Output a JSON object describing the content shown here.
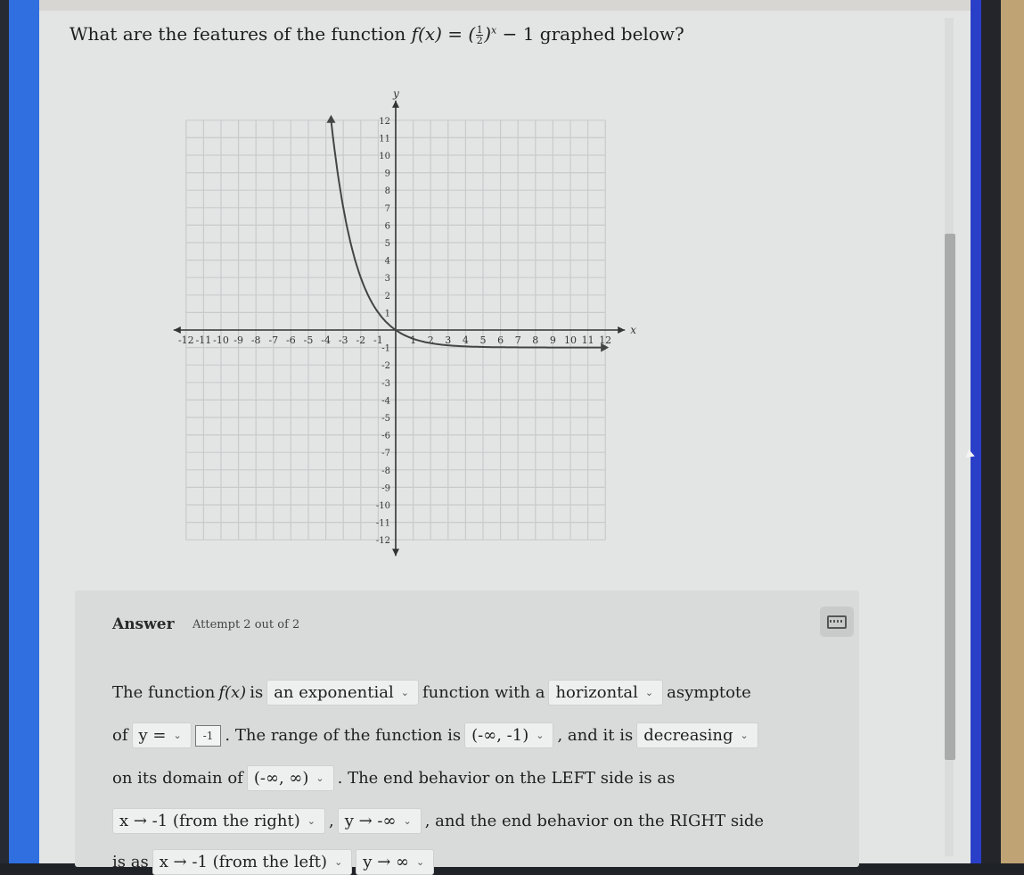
{
  "question": {
    "prefix": "What are the features of the function",
    "func_lhs": "f(x) = (",
    "frac_num": "1",
    "frac_den": "2",
    "func_rhs_paren": ")",
    "exponent": "x",
    "func_tail": " − 1",
    "suffix": "graphed below?"
  },
  "chart_data": {
    "type": "line",
    "title": "",
    "xlabel": "x",
    "ylabel": "y",
    "xlim": [
      -12,
      12
    ],
    "ylim": [
      -12,
      12
    ],
    "grid": true,
    "x_ticks": [
      -12,
      -11,
      -10,
      -9,
      -8,
      -7,
      -6,
      -5,
      -4,
      -3,
      -2,
      -1,
      1,
      2,
      3,
      4,
      5,
      6,
      7,
      8,
      9,
      10,
      11,
      12
    ],
    "y_ticks": [
      -12,
      -11,
      -10,
      -9,
      -8,
      -7,
      -6,
      -5,
      -4,
      -3,
      -2,
      -1,
      1,
      2,
      3,
      4,
      5,
      6,
      7,
      8,
      9,
      10,
      11,
      12
    ],
    "series": [
      {
        "name": "f(x) = (1/2)^x - 1",
        "x": [
          -3.7,
          -3.5,
          -3,
          -2.5,
          -2,
          -1.5,
          -1,
          -0.5,
          0,
          1,
          2,
          3,
          4,
          6,
          8,
          10,
          12
        ],
        "y": [
          12.0,
          10.31,
          7,
          4.66,
          3,
          1.83,
          1,
          0.41,
          0,
          -0.5,
          -0.75,
          -0.875,
          -0.94,
          -0.98,
          -0.996,
          -0.999,
          -1.0
        ]
      }
    ]
  },
  "answer": {
    "label": "Answer",
    "attempt": "Attempt 2 out of 2",
    "keyboard_icon": "keyboard-icon",
    "line1": {
      "t1": "The function",
      "fx": "f(x)",
      "t2": "is",
      "dd1": "an exponential",
      "t3": "function with a",
      "dd2": "horizontal",
      "t4": "asymptote"
    },
    "line2": {
      "t1": "of",
      "dd1": "y =",
      "input": "-1",
      "t2": ". The range of the function is",
      "dd2": "(-∞, -1)",
      "t3": ", and it is",
      "dd3": "decreasing"
    },
    "line3": {
      "t1": "on its domain of",
      "dd1": "(-∞, ∞)",
      "t2": ". The end behavior on the LEFT side is as"
    },
    "line4": {
      "dd1": "x → -1 (from the right)",
      "t1": ",",
      "dd2": "y → -∞",
      "t2": ", and the end behavior on the RIGHT side"
    },
    "line5": {
      "t1": "is as",
      "dd1": "x → -1 (from the left)",
      "dd2": "y → ∞"
    }
  }
}
